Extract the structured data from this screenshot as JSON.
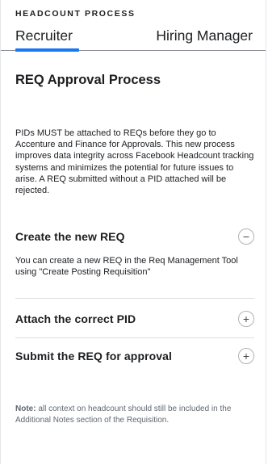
{
  "header": {
    "section_label": "HEADCOUNT PROCESS",
    "tabs": [
      {
        "label": "Recruiter",
        "active": true
      },
      {
        "label": "Hiring Manager",
        "active": false
      }
    ],
    "accent_color": "#1877f2"
  },
  "main": {
    "title": "REQ Approval Process",
    "intro": "PIDs MUST be attached to REQs before they go to Accenture and Finance for Approvals. This new process improves data integrity across Facebook Headcount tracking systems and minimizes the potential for future issues to arise. A REQ submitted without a PID attached will be rejected.",
    "accordion": [
      {
        "title": "Create the new REQ",
        "expanded": true,
        "toggle_icon": "minus-icon",
        "toggle_glyph": "−",
        "body": "You can create a new REQ in the Req Management Tool using \"Create Posting Requisition\""
      },
      {
        "title": "Attach the correct PID",
        "expanded": false,
        "toggle_icon": "plus-icon",
        "toggle_glyph": "+"
      },
      {
        "title": "Submit the REQ for approval",
        "expanded": false,
        "toggle_icon": "plus-icon",
        "toggle_glyph": "+"
      }
    ],
    "note": {
      "label": "Note:",
      "text": " all context on headcount should still be included in the Additional Notes section of the Requisition."
    }
  }
}
